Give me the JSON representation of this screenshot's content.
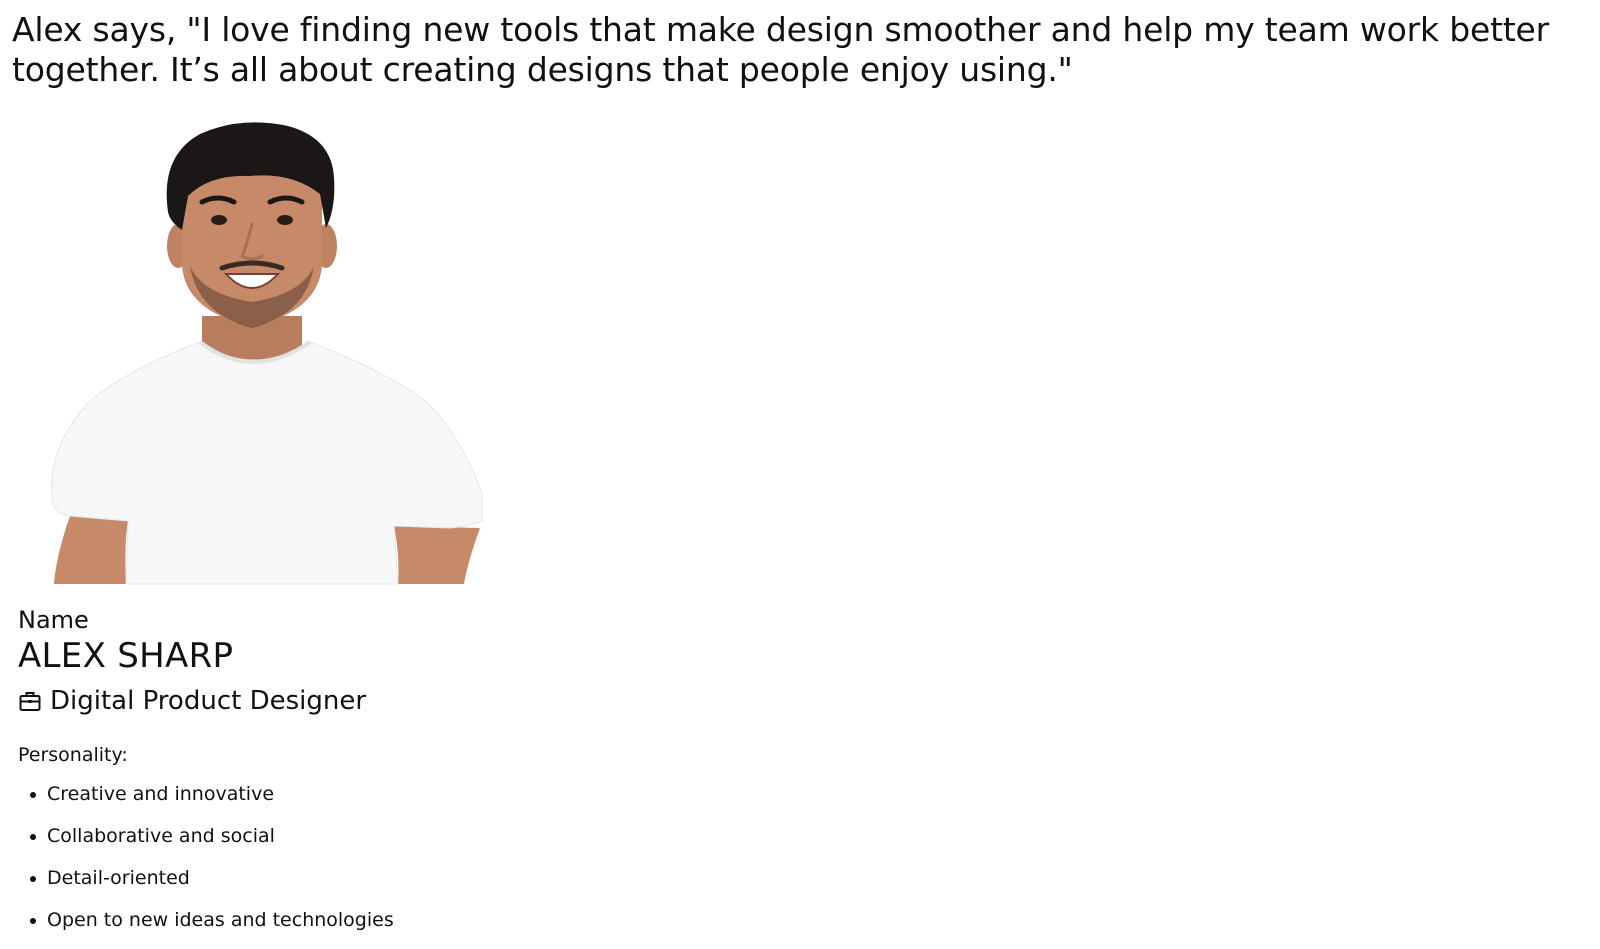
{
  "quote": "Alex says, \"I love finding new tools that make design smoother and help my team work better together. It’s all about creating designs that people enjoy using.\"",
  "profile": {
    "photo_icon": "person-photo",
    "name_label": "Name",
    "name": "ALEX SHARP",
    "role_icon": "briefcase-icon",
    "role": "Digital Product Designer"
  },
  "personality": {
    "heading": "Personality:",
    "traits": [
      "Creative and innovative",
      "Collaborative and social",
      "Detail-oriented",
      "Open to new ideas and technologies"
    ]
  },
  "colors": {
    "text": "#111111",
    "background": "#ffffff",
    "shirt": "#f7f7f7",
    "skin": "#c68a68",
    "hair": "#1b1716"
  }
}
